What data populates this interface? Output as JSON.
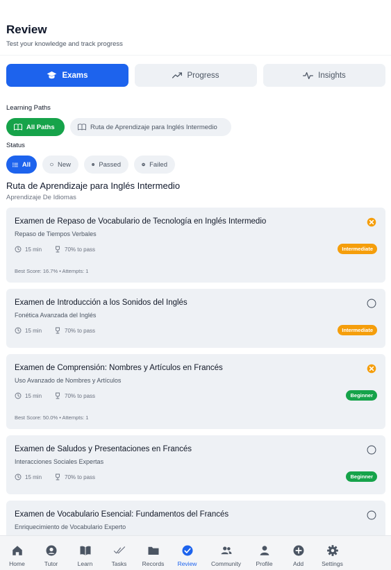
{
  "header": {
    "title": "Review",
    "subtitle": "Test your knowledge and track progress"
  },
  "tabs": [
    {
      "label": "Exams",
      "icon": "graduation-cap-icon",
      "active": true
    },
    {
      "label": "Progress",
      "icon": "trend-line-icon",
      "active": false
    },
    {
      "label": "Insights",
      "icon": "pulse-icon",
      "active": false
    }
  ],
  "filters": {
    "learning_paths_label": "Learning Paths",
    "paths": [
      {
        "label": "All Paths",
        "icon": "book-open-icon",
        "selected": true
      },
      {
        "label": "Ruta de Aprendizaje para Inglés Intermedio",
        "icon": "book-open-icon",
        "selected": false
      }
    ],
    "status_label": "Status",
    "statuses": [
      {
        "label": "All",
        "icon": "list-icon",
        "selected": true
      },
      {
        "label": "New",
        "icon": "circle-icon",
        "selected": false
      },
      {
        "label": "Passed",
        "icon": "check-circle-icon",
        "selected": false
      },
      {
        "label": "Failed",
        "icon": "x-circle-icon",
        "selected": false
      }
    ]
  },
  "path_section": {
    "title": "Ruta de Aprendizaje para Inglés Intermedio",
    "subtitle": "Aprendizaje De Idiomas"
  },
  "exams": [
    {
      "title": "Examen de Repaso de Vocabulario de Tecnología en Inglés Intermedio",
      "subtitle": "Repaso de Tiempos Verbales",
      "duration": "15 min",
      "pass": "70% to pass",
      "level": "Intermediate",
      "status": "failed",
      "score_line": "Best Score: 16.7% • Attempts: 1"
    },
    {
      "title": "Examen de Introducción a los Sonidos del Inglés",
      "subtitle": "Fonética Avanzada del Inglés",
      "duration": "15 min",
      "pass": "70% to pass",
      "level": "Intermediate",
      "status": "new",
      "score_line": ""
    },
    {
      "title": "Examen de Comprensión: Nombres y Artículos en Francés",
      "subtitle": "Uso Avanzado de Nombres y Artículos",
      "duration": "15 min",
      "pass": "70% to pass",
      "level": "Beginner",
      "status": "failed",
      "score_line": "Best Score: 50.0% • Attempts: 1"
    },
    {
      "title": "Examen de Saludos y Presentaciones en Francés",
      "subtitle": "Interacciones Sociales Expertas",
      "duration": "15 min",
      "pass": "70% to pass",
      "level": "Beginner",
      "status": "new",
      "score_line": ""
    },
    {
      "title": "Examen de Vocabulario Esencial: Fundamentos del Francés",
      "subtitle": "Enriquecimiento de Vocabulario Experto",
      "status": "new"
    }
  ],
  "bottom_nav": [
    {
      "label": "Home",
      "icon": "home-icon",
      "active": false
    },
    {
      "label": "Tutor",
      "icon": "tutor-icon",
      "active": false
    },
    {
      "label": "Learn",
      "icon": "book-icon",
      "active": false
    },
    {
      "label": "Tasks",
      "icon": "tasks-icon",
      "active": false
    },
    {
      "label": "Records",
      "icon": "folder-icon",
      "active": false
    },
    {
      "label": "Review",
      "icon": "check-circle-icon",
      "active": true
    },
    {
      "label": "Community",
      "icon": "people-icon",
      "active": false
    },
    {
      "label": "Profile",
      "icon": "person-icon",
      "active": false
    },
    {
      "label": "Add",
      "icon": "plus-circle-icon",
      "active": false
    },
    {
      "label": "Settings",
      "icon": "gear-icon",
      "active": false
    }
  ],
  "colors": {
    "primary": "#1d63ed",
    "success": "#16a34a",
    "warning": "#f59e0b",
    "surface": "#eef1f5"
  }
}
